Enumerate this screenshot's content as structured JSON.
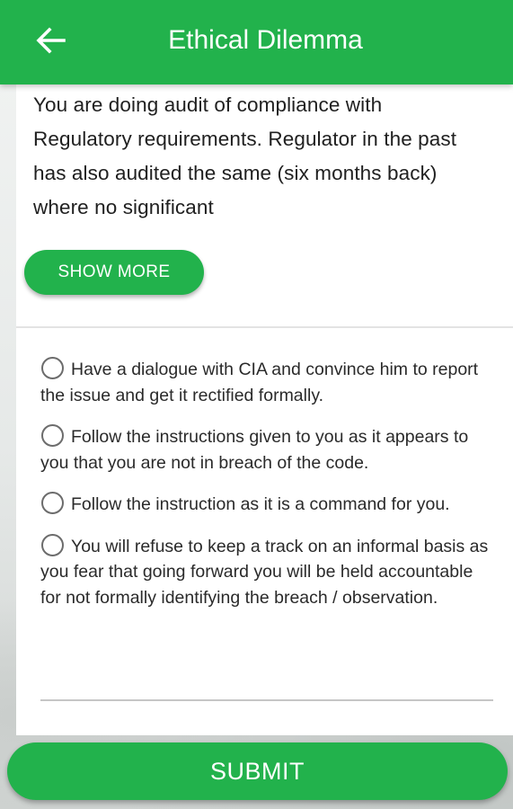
{
  "colors": {
    "primary": "#22b24c",
    "text": "#202020",
    "on_primary": "#ffffff"
  },
  "app_bar": {
    "back_icon": "arrow-back-icon",
    "title": "Ethical Dilemma"
  },
  "question": {
    "text": "You are doing audit of compliance with Regulatory requirements. Regulator in the past has also audited the same (six months back) where no significant",
    "show_more_label": "SHOW MORE"
  },
  "options": [
    {
      "label": "Have a dialogue with CIA and convince him to report the issue and get it rectified formally.",
      "selected": false
    },
    {
      "label": "Follow the instructions given to you as it appears to you that you are not in breach of the code.",
      "selected": false
    },
    {
      "label": "Follow the instruction as it is a command for you.",
      "selected": false
    },
    {
      "label": "You will refuse to keep a track on an informal basis as you fear that going forward you will be held accountable for not formally identifying the breach / observation.",
      "selected": false
    }
  ],
  "submit_label": "SUBMIT"
}
